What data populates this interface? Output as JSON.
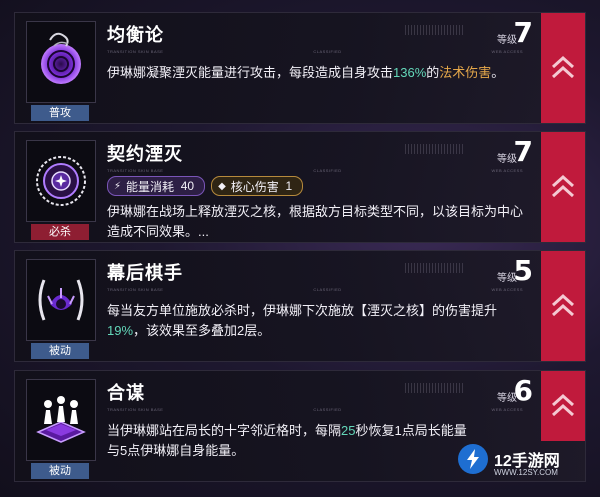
{
  "cards": [
    {
      "title": "均衡论",
      "level_label": "等级",
      "level": "7",
      "tag": "普攻",
      "micro": [
        "TRANSITION SKIN BASE",
        "CLASSIFIED",
        "WEB ACCESS"
      ],
      "desc_parts": [
        "伊琳娜凝聚湮灭能量进行攻击，每段造成自身攻击",
        "136%",
        "的",
        "法术伤害",
        "。"
      ]
    },
    {
      "title": "契约湮灭",
      "level_label": "等级",
      "level": "7",
      "tag": "必杀",
      "micro": [
        "TRANSITION SKIN BASE",
        "CLASSIFIED",
        "WEB ACCESS"
      ],
      "pill1_label": "能量消耗",
      "pill1_value": "40",
      "pill2_label": "核心伤害",
      "pill2_value": "1",
      "desc": "伊琳娜在战场上释放湮灭之核，根据敌方目标类型不同，以该目标为中心造成不同效果。..."
    },
    {
      "title": "幕后棋手",
      "level_label": "等级",
      "level": "5",
      "tag": "被动",
      "micro": [
        "TRANSITION SKIN BASE",
        "CLASSIFIED",
        "WEB ACCESS"
      ],
      "desc_parts": [
        "每当友方单位施放必杀时，伊琳娜下次施放【湮灭之核】的伤害提升",
        "19%",
        "，该效果至多叠加2层。"
      ]
    },
    {
      "title": "合谋",
      "level_label": "等级",
      "level": "6",
      "tag": "被动",
      "micro": [
        "TRANSITION SKIN BASE",
        "CLASSIFIED",
        "WEB ACCESS"
      ],
      "desc_parts": [
        "当伊琳娜站在局长的十字邻近格时，每隔",
        "25",
        "秒恢复1点局长能量与5点伊琳娜自身能量。"
      ]
    }
  ],
  "colors": {
    "accent_red": "#c01a3c",
    "highlight_green": "#63d6b8",
    "highlight_gold": "#e6a84a",
    "tag_blue": "#3e5b8c",
    "tag_red": "#8e1e32"
  },
  "watermark": {
    "name": "12手游网",
    "url": "WWW.12SY.COM"
  }
}
